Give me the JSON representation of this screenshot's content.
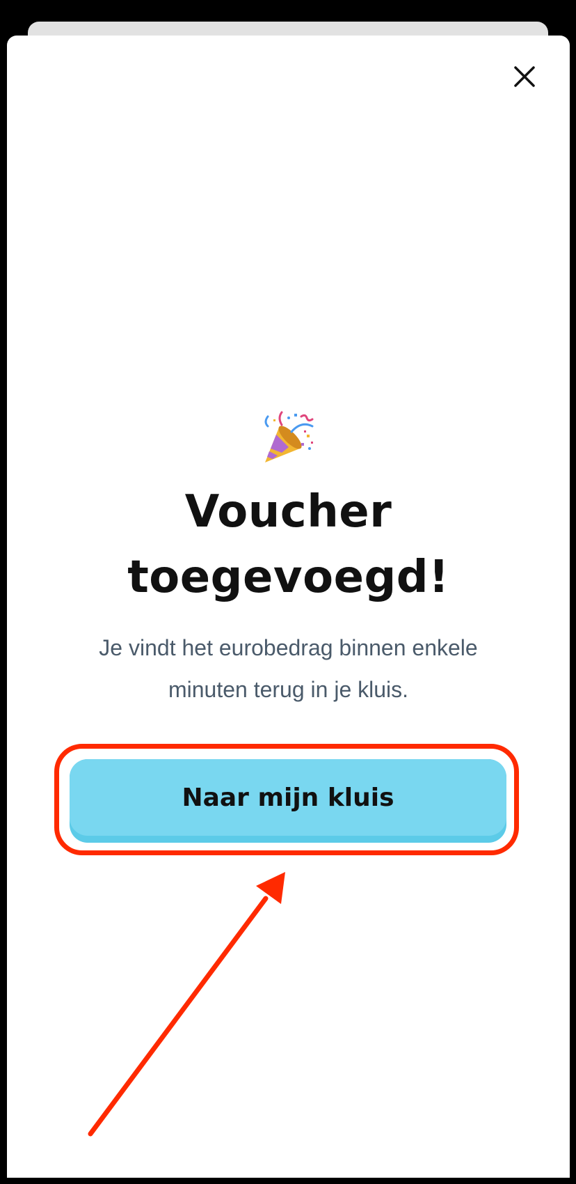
{
  "modal": {
    "title": "Voucher toegevoegd!",
    "message": "Je vindt het eurobedrag binnen enkele minuten terug in je kluis.",
    "cta_label": "Naar mijn kluis",
    "close_icon": "close-icon",
    "emoji_icon": "party-popper-icon"
  },
  "annotation": {
    "highlight_color": "#ff2a00"
  },
  "colors": {
    "cta_fill": "#79d7f0",
    "cta_shadow": "#5ccbe8",
    "title": "#111111",
    "message": "#4a5a6a"
  }
}
